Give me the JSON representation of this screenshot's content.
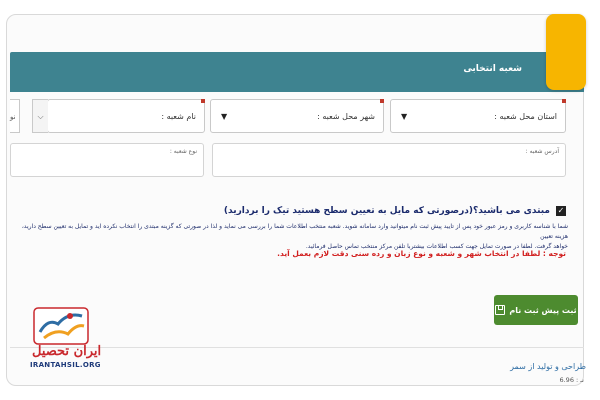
{
  "header": {
    "title": "شعبه انتخابی"
  },
  "fields": {
    "province": {
      "label": "استان محل شعبه :"
    },
    "city": {
      "label": "شهر محل شعبه :"
    },
    "branch_name": {
      "label": "نام شعبه :"
    },
    "edge_stub": "نو",
    "branch_type": {
      "placeholder": "نوع شعبه :"
    },
    "branch_address": {
      "placeholder": "آدرس شعبه :"
    }
  },
  "beginner": {
    "checked": true,
    "label": "مبتدی می باشید؟(درصورتی که مایل به تعیین سطح هستید تیک را بردارید)"
  },
  "info_lines": [
    "شما با شناسه کاربری و رمز عبور خود پس از تایید پیش ثبت نام میتوانید وارد سامانه شوید. شعبه منتخب اطلاعات شما را بررسی می نماید و لذا در صورتی که گزینه مبتدی را انتخاب نکرده اید و تمایل به تعیین سطح دارید، هزینه تعیین",
    "خواهد گرفت. لطفا در صورت تمایل جهت کسب اطلاعات بیشتربا تلفن مرکز منتخب تماس حاصل فرمائید."
  ],
  "warning": "توجه : لطفا در انتخاب شهر و شعبه و نوع زبان و رده سنی دقت لازم بعمل آید.",
  "submit": {
    "label": "ثبت پیش ثبت نام",
    "color": "#4d8b2f"
  },
  "logo": {
    "text": "ایران تحصیل",
    "url": "IRANTAHSIL.ORG"
  },
  "footer": {
    "credit": "طراحی و تولید از سمر",
    "version": "6.96 : نـ"
  },
  "colors": {
    "header": "#3e8390",
    "badge": "#f7b500",
    "warning": "#d11f1f"
  }
}
